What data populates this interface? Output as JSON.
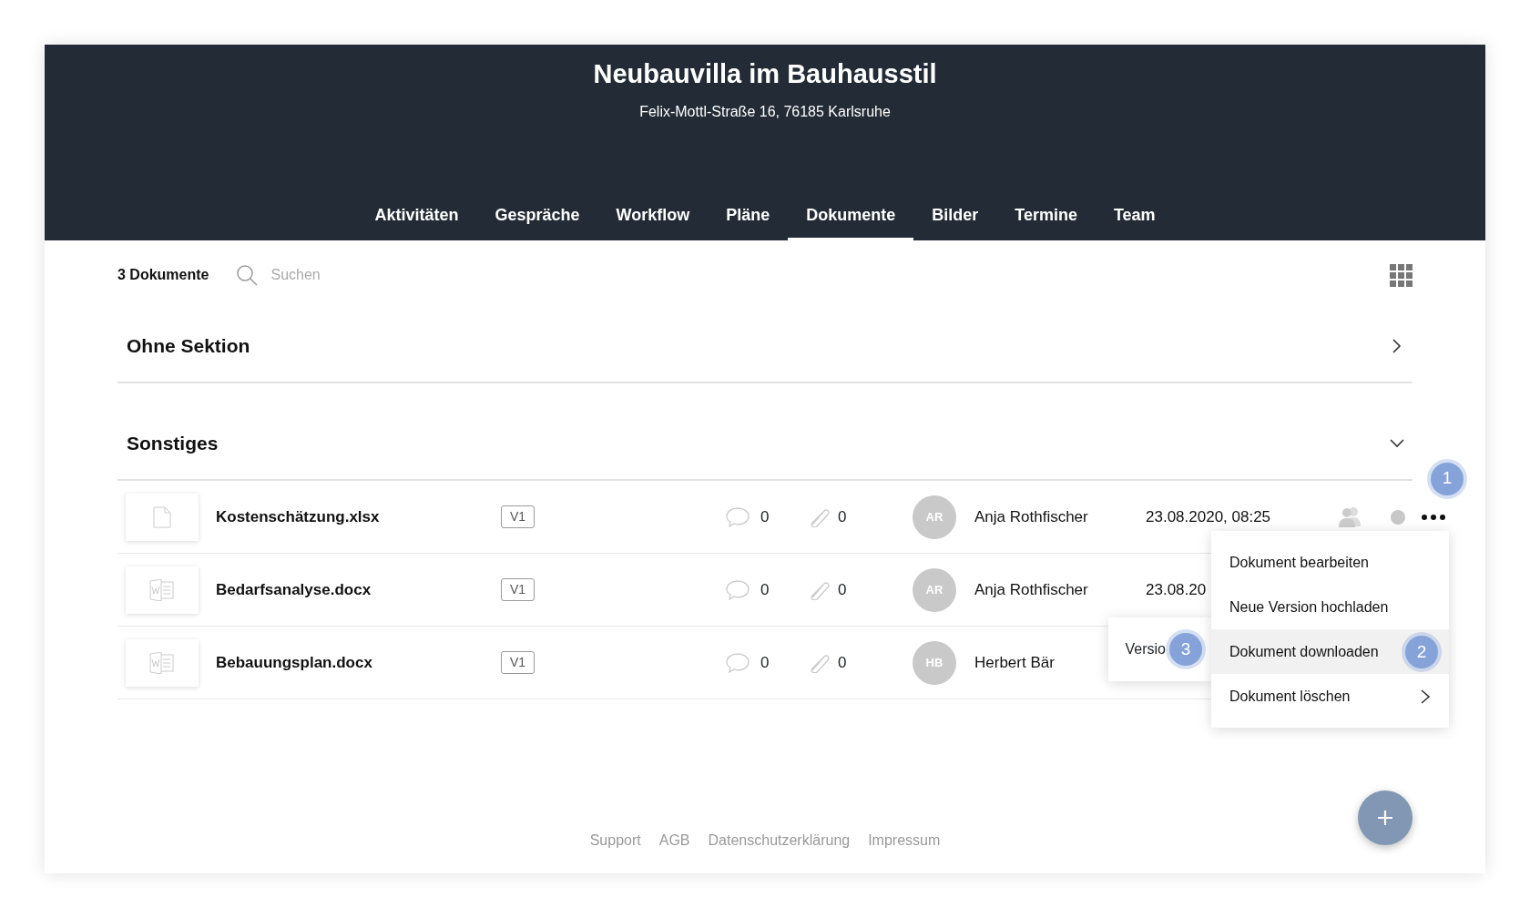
{
  "project": {
    "title": "Neubauvilla im Bauhausstil",
    "address": "Felix-Mottl-Straße 16, 76185 Karlsruhe"
  },
  "tabs": [
    {
      "label": "Aktivitäten",
      "selected": false
    },
    {
      "label": "Gespräche",
      "selected": false
    },
    {
      "label": "Workflow",
      "selected": false
    },
    {
      "label": "Pläne",
      "selected": false
    },
    {
      "label": "Dokumente",
      "selected": true
    },
    {
      "label": "Bilder",
      "selected": false
    },
    {
      "label": "Termine",
      "selected": false
    },
    {
      "label": "Team",
      "selected": false
    }
  ],
  "toolbar": {
    "count": "3 Dokumente",
    "search": {
      "placeholder": "Suchen"
    }
  },
  "sections": [
    {
      "title": "Ohne Sektion",
      "expanded": false
    },
    {
      "title": "Sonstiges",
      "expanded": true,
      "documents": [
        {
          "name": "Kostenschätzung.xlsx",
          "kind": "blank",
          "version": "V1",
          "comments": "0",
          "attachments": "0",
          "initials": "AR",
          "author": "Anja Rothfischer",
          "date": "23.08.2020, 08:25",
          "actions_shown": true,
          "step_badge": "1"
        },
        {
          "name": "Bedarfsanalyse.docx",
          "kind": "word",
          "version": "V1",
          "comments": "0",
          "attachments": "0",
          "initials": "AR",
          "author": "Anja Rothfischer",
          "date": "23.08.20",
          "actions_shown": false
        },
        {
          "name": "Bebauungsplan.docx",
          "kind": "word",
          "version": "V1",
          "comments": "0",
          "attachments": "0",
          "initials": "HB",
          "author": "Herbert Bär",
          "actions_shown": false
        }
      ]
    }
  ],
  "context_menu": {
    "items": [
      {
        "label": "Dokument bearbeiten",
        "highlighted": false,
        "submenu": false
      },
      {
        "label": "Neue Version hochladen",
        "highlighted": false,
        "submenu": false
      },
      {
        "label": "Dokument downloaden",
        "highlighted": true,
        "submenu": false,
        "step_badge": "2"
      },
      {
        "label": "Dokument löschen",
        "highlighted": false,
        "submenu": true
      }
    ],
    "submenu": {
      "label": "Versio",
      "step_badge": "3"
    }
  },
  "footer_links": [
    "Support",
    "AGB",
    "Datenschutzerklärung",
    "Impressum"
  ]
}
